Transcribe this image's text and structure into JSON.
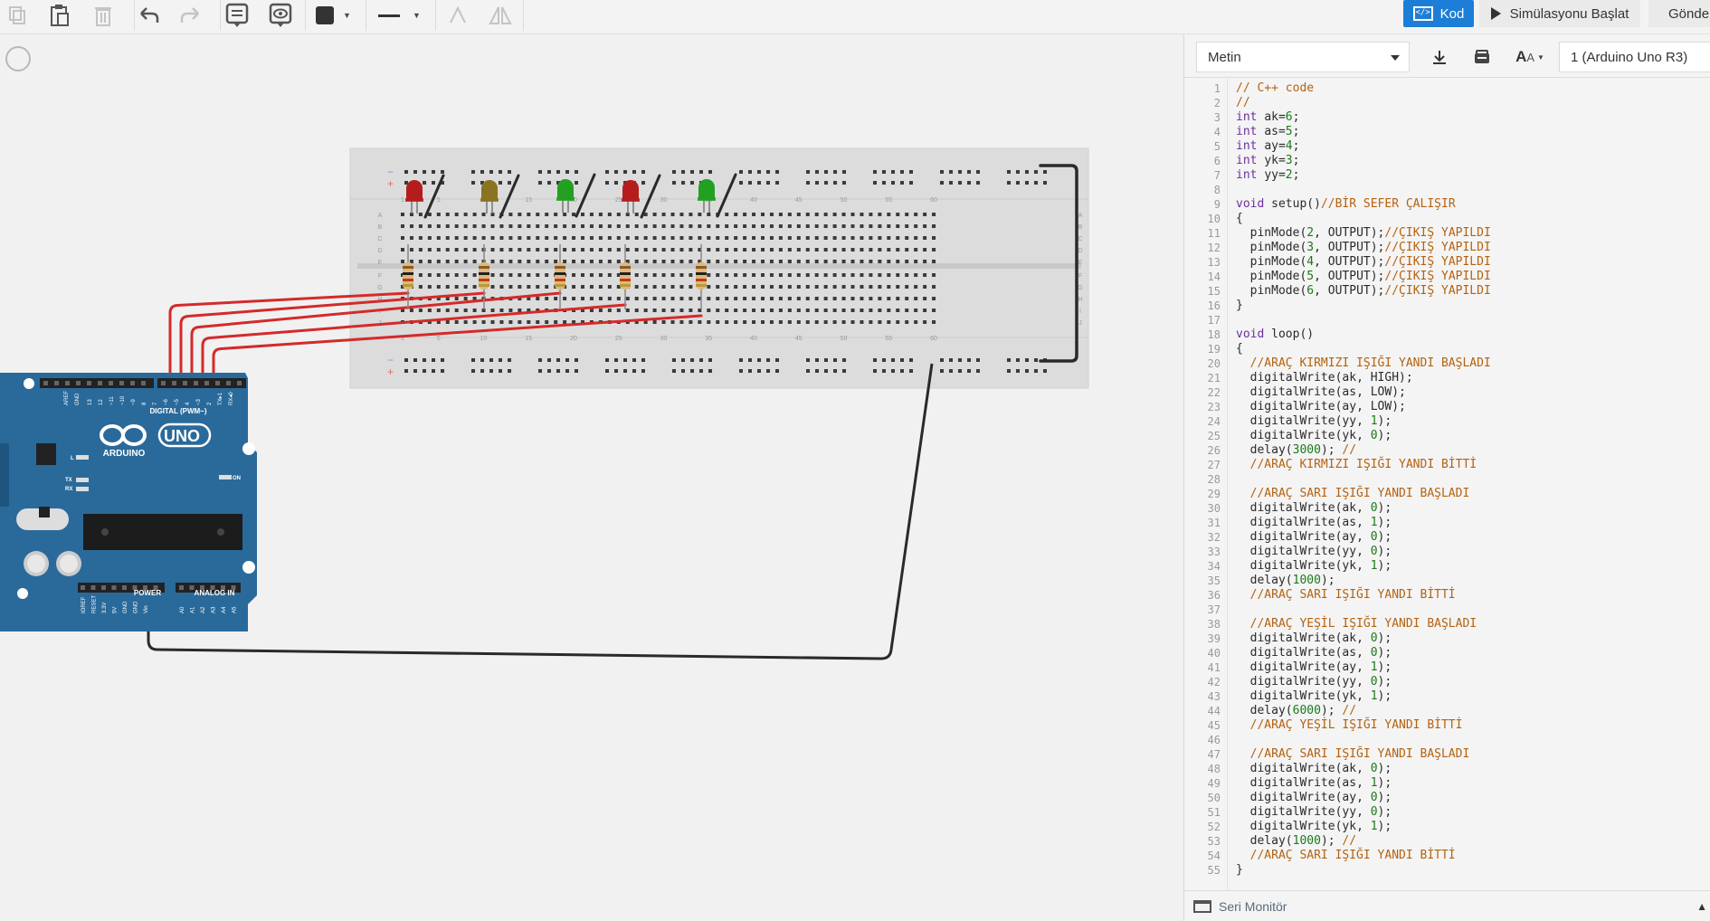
{
  "toolbar": {
    "kod_label": "Kod",
    "sim_label": "Simülasyonu Başlat",
    "gonder_label": "Gönder",
    "icons": [
      "copy-icon",
      "paste-icon",
      "delete-icon",
      "undo-icon",
      "redo-icon",
      "note-icon",
      "eye-icon",
      "fill-color-icon",
      "line-style-icon",
      "flip-icon",
      "mirror-icon"
    ]
  },
  "code_header": {
    "mode": "Metin",
    "board": "1 (Arduino Uno R3)"
  },
  "serial_monitor": "Seri Monitör",
  "arduino": {
    "brand": "ARDUINO",
    "model": "UNO",
    "digital_label": "DIGITAL (PWM~)",
    "power_label": "POWER",
    "analog_label": "ANALOG IN",
    "on_label": "ON",
    "tx_label": "TX",
    "rx_label": "RX",
    "l_label": "L",
    "aref": "AREF",
    "gnd": "GND",
    "pins_digital": [
      "13",
      "12",
      "~11",
      "~10",
      "~9",
      "8",
      "7",
      "~6",
      "~5",
      "4",
      "~3",
      "2",
      "TX▸1",
      "RX◂0"
    ],
    "pins_power": [
      "IOREF",
      "RESET",
      "3.3V",
      "5V",
      "GND",
      "GND",
      "Vin"
    ],
    "pins_analog": [
      "A0",
      "A1",
      "A2",
      "A3",
      "A4",
      "A5"
    ]
  },
  "breadboard": {
    "col_numbers": [
      "1",
      "5",
      "10",
      "15",
      "20",
      "25",
      "30",
      "35",
      "40",
      "45",
      "50",
      "55",
      "60"
    ],
    "row_letters_top": [
      "A",
      "B",
      "C",
      "D",
      "E"
    ],
    "row_letters_bottom": [
      "F",
      "G",
      "H",
      "I",
      "J"
    ]
  },
  "leds": [
    {
      "name": "led-red-1",
      "color": "#b51d1d"
    },
    {
      "name": "led-yellow",
      "color": "#8a7321"
    },
    {
      "name": "led-green-1",
      "color": "#22a022"
    },
    {
      "name": "led-red-2",
      "color": "#b51d1d"
    },
    {
      "name": "led-green-2",
      "color": "#22a022"
    }
  ],
  "code_lines": [
    {
      "n": "1",
      "t": "// C++ code"
    },
    {
      "n": "2",
      "t": "//"
    },
    {
      "n": "3",
      "t": "int ak=6;"
    },
    {
      "n": "4",
      "t": "int as=5;"
    },
    {
      "n": "5",
      "t": "int ay=4;"
    },
    {
      "n": "6",
      "t": "int yk=3;"
    },
    {
      "n": "7",
      "t": "int yy=2;"
    },
    {
      "n": "8",
      "t": ""
    },
    {
      "n": "9",
      "t": "void setup()//BİR SEFER ÇALIŞIR"
    },
    {
      "n": "10",
      "t": "{"
    },
    {
      "n": "11",
      "t": "  pinMode(2, OUTPUT);//ÇIKIŞ YAPILDI"
    },
    {
      "n": "12",
      "t": "  pinMode(3, OUTPUT);//ÇIKIŞ YAPILDI"
    },
    {
      "n": "13",
      "t": "  pinMode(4, OUTPUT);//ÇIKIŞ YAPILDI"
    },
    {
      "n": "14",
      "t": "  pinMode(5, OUTPUT);//ÇIKIŞ YAPILDI"
    },
    {
      "n": "15",
      "t": "  pinMode(6, OUTPUT);//ÇIKIŞ YAPILDI"
    },
    {
      "n": "16",
      "t": "}"
    },
    {
      "n": "17",
      "t": ""
    },
    {
      "n": "18",
      "t": "void loop()"
    },
    {
      "n": "19",
      "t": "{"
    },
    {
      "n": "20",
      "t": "  //ARAÇ KIRMIZI IŞIĞI YANDI BAŞLADI"
    },
    {
      "n": "21",
      "t": "  digitalWrite(ak, HIGH);"
    },
    {
      "n": "22",
      "t": "  digitalWrite(as, LOW);"
    },
    {
      "n": "23",
      "t": "  digitalWrite(ay, LOW);"
    },
    {
      "n": "24",
      "t": "  digitalWrite(yy, 1);"
    },
    {
      "n": "25",
      "t": "  digitalWrite(yk, 0);"
    },
    {
      "n": "26",
      "t": "  delay(3000); //"
    },
    {
      "n": "27",
      "t": "  //ARAÇ KIRMIZI IŞIĞI YANDI BİTTİ"
    },
    {
      "n": "28",
      "t": ""
    },
    {
      "n": "29",
      "t": "  //ARAÇ SARI IŞIĞI YANDI BAŞLADI"
    },
    {
      "n": "30",
      "t": "  digitalWrite(ak, 0);"
    },
    {
      "n": "31",
      "t": "  digitalWrite(as, 1);"
    },
    {
      "n": "32",
      "t": "  digitalWrite(ay, 0);"
    },
    {
      "n": "33",
      "t": "  digitalWrite(yy, 0);"
    },
    {
      "n": "34",
      "t": "  digitalWrite(yk, 1);"
    },
    {
      "n": "35",
      "t": "  delay(1000);"
    },
    {
      "n": "36",
      "t": "  //ARAÇ SARI IŞIĞI YANDI BİTTİ"
    },
    {
      "n": "37",
      "t": ""
    },
    {
      "n": "38",
      "t": "  //ARAÇ YEŞİL IŞIĞI YANDI BAŞLADI"
    },
    {
      "n": "39",
      "t": "  digitalWrite(ak, 0);"
    },
    {
      "n": "40",
      "t": "  digitalWrite(as, 0);"
    },
    {
      "n": "41",
      "t": "  digitalWrite(ay, 1);"
    },
    {
      "n": "42",
      "t": "  digitalWrite(yy, 0);"
    },
    {
      "n": "43",
      "t": "  digitalWrite(yk, 1);"
    },
    {
      "n": "44",
      "t": "  delay(6000); //"
    },
    {
      "n": "45",
      "t": "  //ARAÇ YEŞİL IŞIĞI YANDI BİTTİ"
    },
    {
      "n": "46",
      "t": ""
    },
    {
      "n": "47",
      "t": "  //ARAÇ SARI IŞIĞI YANDI BAŞLADI"
    },
    {
      "n": "48",
      "t": "  digitalWrite(ak, 0);"
    },
    {
      "n": "49",
      "t": "  digitalWrite(as, 1);"
    },
    {
      "n": "50",
      "t": "  digitalWrite(ay, 0);"
    },
    {
      "n": "51",
      "t": "  digitalWrite(yy, 0);"
    },
    {
      "n": "52",
      "t": "  digitalWrite(yk, 1);"
    },
    {
      "n": "53",
      "t": "  delay(1000); //"
    },
    {
      "n": "54",
      "t": "  //ARAÇ SARI IŞIĞI YANDI BİTTİ"
    },
    {
      "n": "55",
      "t": "}"
    }
  ],
  "colors": {
    "accent": "#1c7ed6",
    "arduino_blue": "#2a6a9a",
    "wire_red": "#d42a2a",
    "wire_black": "#2a2a2a",
    "breadboard": "#dcdcdc"
  }
}
